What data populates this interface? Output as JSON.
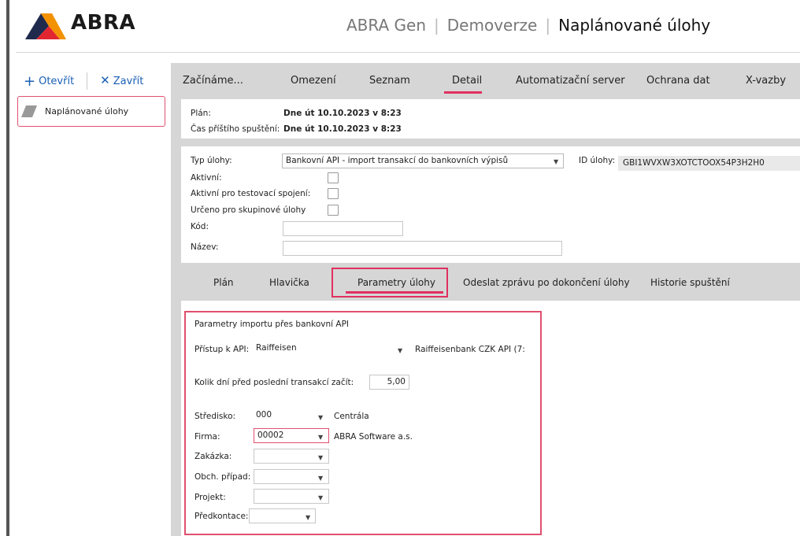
{
  "app": {
    "logo_text": "ABRA",
    "title_app": "ABRA Gen",
    "title_edition": "Demoverze",
    "title_page": "Naplánované úlohy"
  },
  "sidebar": {
    "open_label": "Otevřít",
    "close_label": "Zavřít",
    "items": [
      {
        "label": "Naplánované úlohy"
      }
    ]
  },
  "topnav": {
    "tabs": [
      {
        "label": "Začínáme..."
      },
      {
        "label": "Omezení"
      },
      {
        "label": "Seznam"
      },
      {
        "label": "Detail",
        "active": true
      },
      {
        "label": "Automatizační server"
      },
      {
        "label": "Ochrana dat"
      },
      {
        "label": "X-vazby"
      }
    ]
  },
  "plan": {
    "plan_label": "Plán:",
    "plan_value": "Dne út 10.10.2023 v 8:23",
    "next_label": "Čas příštího spuštění:",
    "next_value": "Dne út 10.10.2023 v 8:23"
  },
  "form": {
    "type_label": "Typ úlohy:",
    "type_value": "Bankovní API - import transakcí do bankovních výpisů",
    "id_label": "ID úlohy:",
    "id_value": "GBI1WVXW3XOTCTOOX54P3H2H0",
    "active_label": "Aktivní:",
    "active_test_label": "Aktivní pro testovací spojení:",
    "group_label": "Určeno pro skupinové úlohy",
    "code_label": "Kód:",
    "code_value": "",
    "name_label": "Název:",
    "name_value": ""
  },
  "subtabs": {
    "tabs": [
      {
        "label": "Plán"
      },
      {
        "label": "Hlavička"
      },
      {
        "label": "Parametry úlohy",
        "active": true
      },
      {
        "label": "Odeslat zprávu po dokončení úlohy"
      },
      {
        "label": "Historie spuštění"
      }
    ]
  },
  "params": {
    "section_title": "Parametry importu přes bankovní API",
    "api_label": "Přístup k API:",
    "api_value": "Raiffeisen",
    "api_desc": "Raiffeisenbank CZK API (7:",
    "days_label": "Kolik dní před poslední transakcí začít:",
    "days_value": "5,00",
    "fields": [
      {
        "label": "Středisko:",
        "value": "000",
        "desc": "Centrála"
      },
      {
        "label": "Firma:",
        "value": "00002",
        "desc": "ABRA Software a.s."
      },
      {
        "label": "Zakázka:",
        "value": "",
        "desc": ""
      },
      {
        "label": "Obch. případ:",
        "value": "",
        "desc": ""
      },
      {
        "label": "Projekt:",
        "value": "",
        "desc": ""
      },
      {
        "label": "Předkontace:",
        "value": "",
        "desc": ""
      }
    ]
  },
  "colors": {
    "accent": "#e03060",
    "brand_orange": "#f39200",
    "link_blue": "#1a5fb4"
  }
}
